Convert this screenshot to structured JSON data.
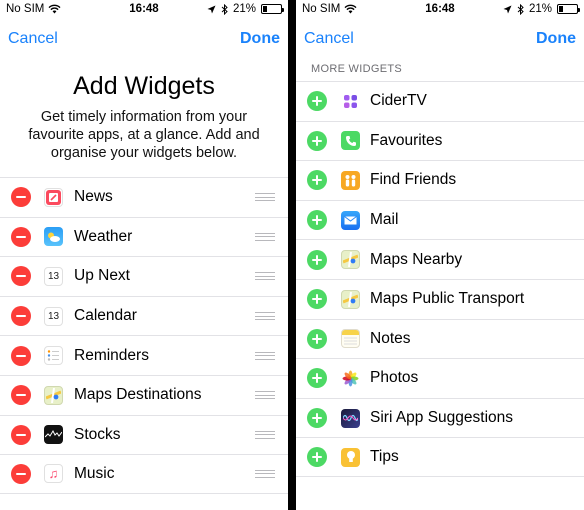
{
  "left": {
    "status": {
      "carrier": "No SIM",
      "time": "16:48",
      "battery": "21%"
    },
    "nav": {
      "cancel": "Cancel",
      "done": "Done"
    },
    "title": "Add Widgets",
    "subtitle": "Get timely information from your favourite apps, at a glance. Add and organise your widgets below.",
    "widgets": [
      {
        "label": "News",
        "icon": "news-icon"
      },
      {
        "label": "Weather",
        "icon": "weather-icon"
      },
      {
        "label": "Up Next",
        "icon": "calendar-icon",
        "icon_text": "13"
      },
      {
        "label": "Calendar",
        "icon": "calendar-icon",
        "icon_text": "13"
      },
      {
        "label": "Reminders",
        "icon": "reminders-icon"
      },
      {
        "label": "Maps Destinations",
        "icon": "maps-icon"
      },
      {
        "label": "Stocks",
        "icon": "stocks-icon"
      },
      {
        "label": "Music",
        "icon": "music-icon"
      }
    ]
  },
  "right": {
    "status": {
      "carrier": "No SIM",
      "time": "16:48",
      "battery": "21%"
    },
    "nav": {
      "cancel": "Cancel",
      "done": "Done"
    },
    "section_header": "MORE WIDGETS",
    "widgets": [
      {
        "label": "CiderTV",
        "icon": "cidertv-icon"
      },
      {
        "label": "Favourites",
        "icon": "phone-icon"
      },
      {
        "label": "Find Friends",
        "icon": "find-friends-icon"
      },
      {
        "label": "Mail",
        "icon": "mail-icon"
      },
      {
        "label": "Maps Nearby",
        "icon": "maps-icon"
      },
      {
        "label": "Maps Public Transport",
        "icon": "maps-icon"
      },
      {
        "label": "Notes",
        "icon": "notes-icon"
      },
      {
        "label": "Photos",
        "icon": "photos-icon"
      },
      {
        "label": "Siri App Suggestions",
        "icon": "siri-icon"
      },
      {
        "label": "Tips",
        "icon": "tips-icon"
      }
    ]
  },
  "colors": {
    "accent": "#1a82fb",
    "remove": "#fc3d39",
    "add": "#4cd964",
    "separator": "#e2e2e6"
  }
}
